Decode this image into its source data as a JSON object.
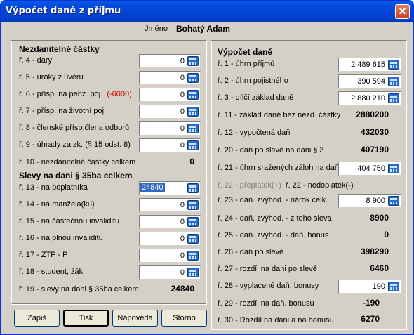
{
  "window": {
    "title": "Výpočet  daně z příjmu",
    "close_glyph": "✕"
  },
  "header": {
    "name_label": "Jméno",
    "name_value": "Bohatý Adam"
  },
  "left": {
    "section1_title": "Nezdanitelné částky",
    "items": [
      {
        "label": "ř. 4 - dary",
        "value": "0"
      },
      {
        "label": "ř. 5 - úroky z úvěru",
        "value": "0"
      },
      {
        "label": "ř. 6 - přísp. na penz. poj.",
        "note": "(-6000)",
        "value": "0"
      },
      {
        "label": "ř. 7 - přísp. na životní poj.",
        "value": "0"
      },
      {
        "label": "ř. 8 - členské přísp.člena odborů",
        "value": "0"
      },
      {
        "label": "ř. 9 - úhrady za zk. (§ 15 odst. 8)",
        "value": "0"
      }
    ],
    "r10_label": "ř. 10 - nezdanitelné částky celkem",
    "r10_value": "0",
    "section2_title": "Slevy na dani § 35ba celkem",
    "slevy": [
      {
        "label": "ř. 13 - na poplatníka",
        "value": "24840"
      },
      {
        "label": "ř. 14 - na manžela(ku)",
        "value": "0"
      },
      {
        "label": "ř. 15 - na částečnou invaliditu",
        "value": "0"
      },
      {
        "label": "ř. 16 - na plnou invaliditu",
        "value": "0"
      },
      {
        "label": "ř. 17 - ZTP - P",
        "value": "0"
      },
      {
        "label": "ř. 18 - student, žák",
        "value": "0"
      }
    ],
    "r19_label": "ř. 19 - slevy na dani § 35ba celkem",
    "r19_value": "24840"
  },
  "right": {
    "title": "Výpočet daně",
    "r1_label": "ř. 1 - úhrn příjmů",
    "r1_value": "2 489 615",
    "r2_label": "ř. 2 - úhrn pojistného",
    "r2_value": "390 594",
    "r3_label": "ř. 3 - dílčí základ daně",
    "r3_value": "2 880 210",
    "r11_label": "ř. 11 - základ daně bez nezd. částky",
    "r11_value": "2880200",
    "r12_label": "ř. 12 - vypočtená daň",
    "r12_value": "432030",
    "r20_label": "ř. 20 - daň po slevě na dani § 3",
    "r20_value": "407190",
    "r21_label": "ř. 21 - úhrn sražených záloh na daň",
    "r21_value": "404 750",
    "r22a_label": "ř. 22 - přeplatek(+)",
    "r22b_label": "ř. 22 - nedoplatek(-)",
    "r23_label": "ř. 23 - daň. zvýhod. - nárok celk.",
    "r23_value": "8 900",
    "r24_label": "ř. 24 - daň. zvýhod. - z toho sleva",
    "r24_value": "8900",
    "r25_label": "ř. 25 - daň. zvýhod. - daň. bonus",
    "r25_value": "0",
    "r26_label": "ř. 26 - daň po slevě",
    "r26_value": "398290",
    "r27_label": "ř. 27 - rozdíl na dani po slevě",
    "r27_value": "6460",
    "r28_label": "ř. 28 - vyplacené daň. bonusy",
    "r28_value": "190",
    "r29_label": "ř. 29 - rozdíl na daň. bonusu",
    "r29_value": "-190",
    "r30_label": "ř. 30 - Rozdíl na dani a na bonusu",
    "r30_value": "6270"
  },
  "buttons": {
    "zapis": "Zapiš",
    "tisk": "Tisk",
    "napoveda": "Nápověda",
    "storno": "Storno"
  }
}
